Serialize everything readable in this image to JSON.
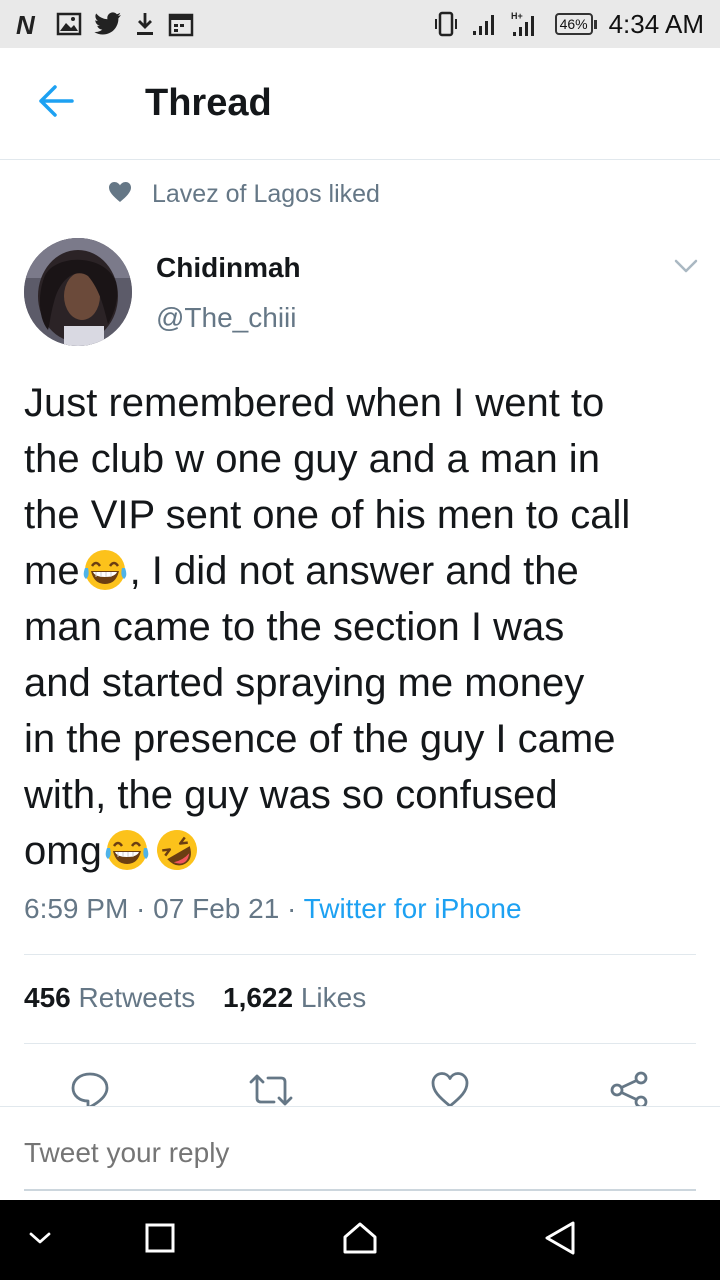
{
  "status_bar": {
    "left_icons": [
      "netflix-n-icon",
      "gallery-icon",
      "twitter-bird-icon",
      "download-icon",
      "calendar-icon"
    ],
    "right_icons": [
      "vibrate-icon",
      "signal-icon",
      "signal-ht-icon"
    ],
    "battery": "46%",
    "time": "4:34 AM"
  },
  "header": {
    "title": "Thread",
    "accent": "#1da1f2"
  },
  "social_context": {
    "text": "Lavez of Lagos liked"
  },
  "tweet": {
    "author_name": "Chidinmah",
    "author_handle": "@The_chiii",
    "text_lines": [
      "Just remembered when I went to",
      "the club w one guy and a man in",
      "the VIP sent one of his men to call",
      "me",
      ", I did not answer and the",
      "man came to the section I was",
      "and started spraying me money",
      "in the presence of the guy I came",
      "with, the guy was so confused",
      "omg"
    ],
    "time": "6:59 PM",
    "date": "07 Feb 21",
    "source": "Twitter for iPhone",
    "retweets_count": "456",
    "retweets_label": "Retweets",
    "likes_count": "1,622",
    "likes_label": "Likes"
  },
  "reply": {
    "placeholder": "Tweet your reply"
  },
  "colors": {
    "text": "#14171a",
    "secondary": "#657786",
    "link": "#1da1f2",
    "divider": "#e1e8ed"
  }
}
